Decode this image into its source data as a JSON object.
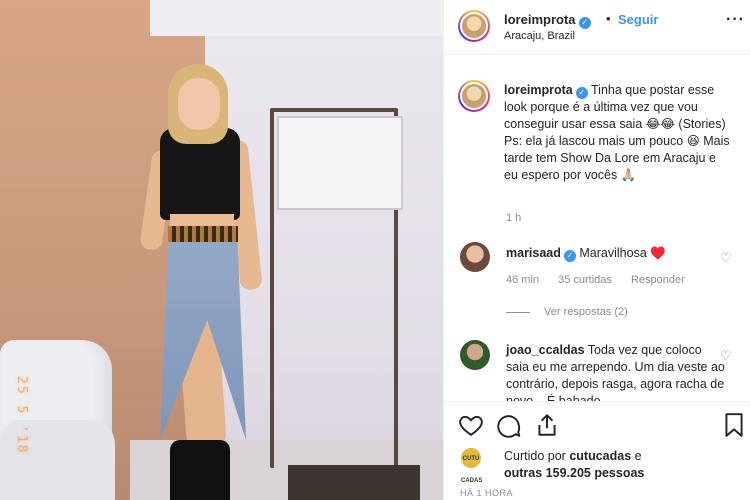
{
  "photo": {
    "date_stamp": "25 5 '18"
  },
  "header": {
    "username": "loreimprota",
    "separator": "•",
    "follow_label": "Seguir",
    "location": "Aracaju, Brazil",
    "more_icon": "more-horizontal-icon"
  },
  "caption": {
    "username": "loreimprota",
    "text": "Tinha que postar esse look porque é a última vez que vou conseguir usar essa saia 😂😂 (Stories) Ps: ela já lascou mais um pouco 😆 Mais tarde tem Show Da Lore em Aracaju e eu espero por vocês 🙏🏼",
    "time": "1 h"
  },
  "comments": [
    {
      "username": "marisaad",
      "text": "Maravilhosa ♥️",
      "time": "46 min",
      "likes": "35 curtidas",
      "reply_label": "Responder",
      "view_replies": "Ver respostas (2)"
    },
    {
      "username": "joao_ccaldas",
      "text": "Toda vez que coloco saia eu me arrependo. Um dia veste ao contrário, depois rasga, agora racha de novo... É babado"
    }
  ],
  "likes": {
    "prefix": "Curtido por",
    "user": "cutucadas",
    "suffix": " e",
    "others": "outras 159.205 pessoas",
    "avatar_label": "CUTU CADAS"
  },
  "posted": "HÁ 1 HORA",
  "colors": {
    "accent": "#3897f0",
    "text": "#262626",
    "muted": "#8e8e8e"
  }
}
